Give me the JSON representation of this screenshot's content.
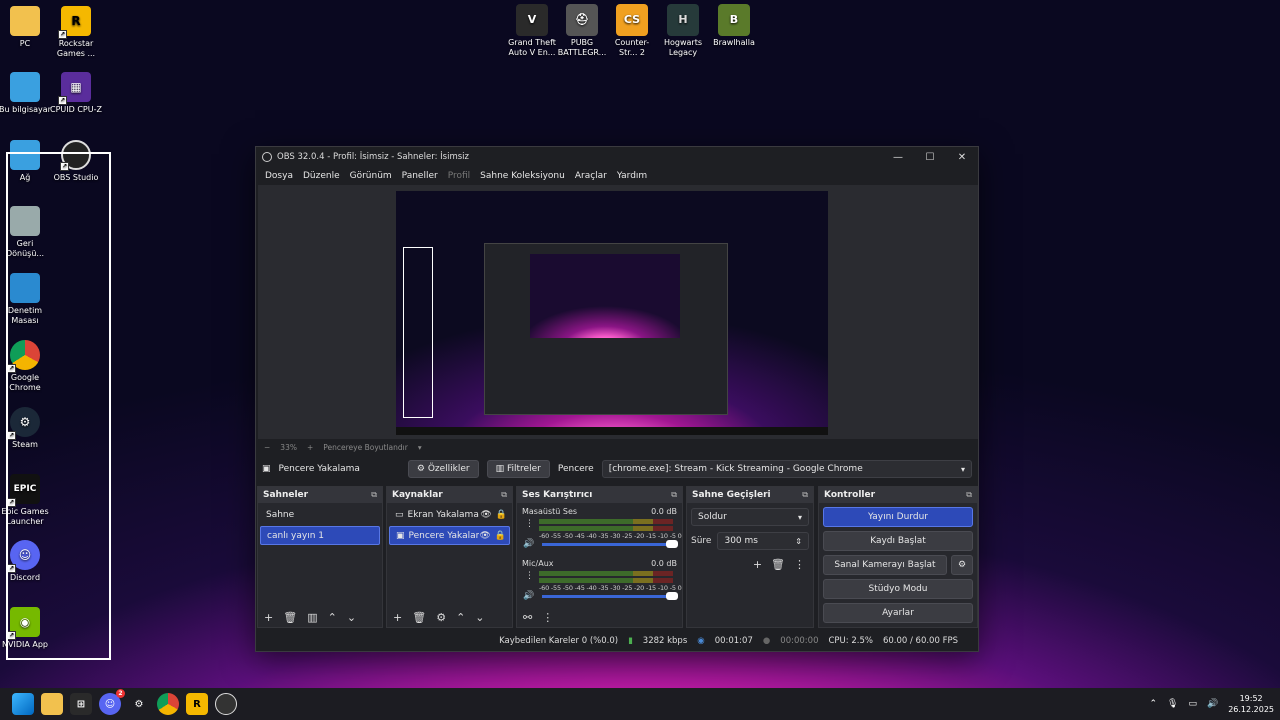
{
  "desktop_icons": [
    {
      "label": "PC",
      "icon": "folder-icon",
      "color": "#f2c14e"
    },
    {
      "label": "Rockstar Games ...",
      "icon": "rockstar-icon",
      "color": "#f5b800"
    },
    {
      "label": "Bu bilgisayar",
      "icon": "monitor-icon",
      "color": "#3aa0e0"
    },
    {
      "label": "CPUID CPU-Z",
      "icon": "cpuz-icon",
      "color": "#5a2d9c"
    },
    {
      "label": "Ağ",
      "icon": "network-icon",
      "color": "#3aa0e0"
    },
    {
      "label": "OBS Studio",
      "icon": "obs-icon",
      "color": "#222"
    },
    {
      "label": "Geri Dönüşü...",
      "icon": "recycle-bin-icon",
      "color": "#9aa"
    },
    {
      "label": "Denetim Masası",
      "icon": "control-panel-icon",
      "color": "#2a8ad0"
    },
    {
      "label": "Google Chrome",
      "icon": "chrome-icon",
      "color": "#db4437"
    },
    {
      "label": "Steam",
      "icon": "steam-icon",
      "color": "#1b2838"
    },
    {
      "label": "Epic Games Launcher",
      "icon": "epic-icon",
      "color": "#111"
    },
    {
      "label": "Discord",
      "icon": "discord-icon",
      "color": "#5865f2"
    },
    {
      "label": "NVIDIA App",
      "icon": "nvidia-icon",
      "color": "#76b900"
    }
  ],
  "top_icons": [
    {
      "label": "Grand Theft Auto V En...",
      "icon": "gta-icon",
      "color": "#2a2a2a"
    },
    {
      "label": "PUBG BATTLEGR...",
      "icon": "pubg-icon",
      "color": "#555"
    },
    {
      "label": "Counter-Str... 2",
      "icon": "cs2-icon",
      "color": "#f0a020"
    },
    {
      "label": "Hogwarts Legacy",
      "icon": "hogwarts-icon",
      "color": "#263a3a"
    },
    {
      "label": "Brawlhalla",
      "icon": "brawlhalla-icon",
      "color": "#5a7a2a"
    }
  ],
  "obs": {
    "title": "OBS 32.0.4 - Profil: İsimsiz - Sahneler: İsimsiz",
    "menu": [
      "Dosya",
      "Düzenle",
      "Görünüm",
      "Paneller",
      "Profil",
      "Sahne Koleksiyonu",
      "Araçlar",
      "Yardım"
    ],
    "zoom": {
      "minus": "−",
      "value": "33%",
      "plus": "+",
      "fit": "Pencereye Boyutlandır"
    },
    "source_toolbar": {
      "source": "Pencere Yakalama",
      "props": "Özellikler",
      "filters": "Filtreler",
      "window_label": "Pencere",
      "window_value": "[chrome.exe]: Stream - Kick Streaming - Google Chrome"
    },
    "scenes": {
      "title": "Sahneler",
      "items": [
        "Sahne",
        "canlı yayın 1"
      ],
      "selected": 1
    },
    "sources": {
      "title": "Kaynaklar",
      "items": [
        "Ekran Yakalama",
        "Pencere Yakalam"
      ],
      "selected": 1
    },
    "mixer": {
      "title": "Ses Karıştırıcı",
      "channels": [
        {
          "name": "Masaüstü Ses",
          "db": "0.0 dB"
        },
        {
          "name": "Mic/Aux",
          "db": "0.0 dB"
        }
      ],
      "scale": "-60 -55 -50 -45 -40 -35 -30 -25 -20 -15 -10 -5 0"
    },
    "transitions": {
      "title": "Sahne Geçişleri",
      "type": "Soldur",
      "duration_label": "Süre",
      "duration": "300 ms"
    },
    "controls": {
      "title": "Kontroller",
      "stop_stream": "Yayını Durdur",
      "start_record": "Kaydı Başlat",
      "virtual_cam": "Sanal Kamerayı Başlat",
      "studio": "Stüdyo Modu",
      "settings": "Ayarlar"
    },
    "status": {
      "dropped": "Kaybedilen Kareler 0 (%0.0)",
      "bitrate": "3282 kbps",
      "stream_time": "00:01:07",
      "rec_time": "00:00:00",
      "cpu": "CPU: 2.5%",
      "fps": "60.00 / 60.00 FPS"
    }
  },
  "taskbar": {
    "time": "19:52",
    "date": "26.12.2025",
    "discord_badge": "2"
  }
}
